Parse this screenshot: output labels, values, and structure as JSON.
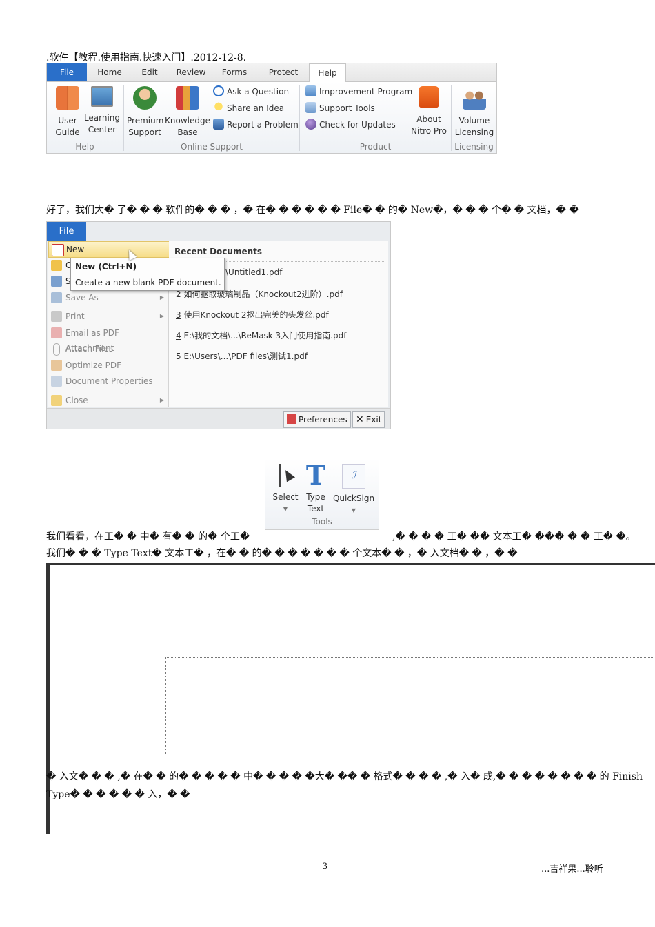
{
  "header": {
    "text": ".软件【教程.使用指南.快速入门】.2012-12-8."
  },
  "ribbon": {
    "tabs": [
      "File",
      "Home",
      "Edit",
      "Review",
      "Forms",
      "Protect",
      "Help"
    ],
    "groups": {
      "help": {
        "label": "Help",
        "user_guide": [
          "User",
          "Guide"
        ],
        "learning_center": [
          "Learning",
          "Center"
        ]
      },
      "online_support": {
        "label": "Online Support",
        "premium_support": [
          "Premium",
          "Support"
        ],
        "knowledge_base": [
          "Knowledge",
          "Base"
        ],
        "ask_question": "Ask a Question",
        "share_idea": "Share an Idea",
        "report_problem": "Report a Problem"
      },
      "product": {
        "label": "Product",
        "improvement": "Improvement Program",
        "support_tools": "Support Tools",
        "check_updates": "Check for Updates",
        "about": [
          "About",
          "Nitro Pro"
        ]
      },
      "licensing": {
        "label": "Licensing",
        "volume": [
          "Volume",
          "Licensing"
        ]
      }
    }
  },
  "para1": "好了，我们大� 了� � � 软件的� � � ，� 在� � � � � � File� � 的� New�，� � � 个� � 文档，� �",
  "file_menu": {
    "tab": "File",
    "items": {
      "new": "New",
      "open_initial": "O",
      "save_initial": "S",
      "save_as": "Save As",
      "print": "Print",
      "email": "Email as PDF Attachment",
      "attach": "Attach Files",
      "optimize": "Optimize PDF",
      "properties": "Document Properties",
      "close": "Close"
    },
    "tooltip": {
      "title": "New (Ctrl+N)",
      "desc": "Create a new blank PDF document."
    },
    "recent_header": "Recent Documents",
    "recent": [
      {
        "num": "",
        "path": "\\Untitled1.pdf"
      },
      {
        "num": "2",
        "path": " 如何抠取玻璃制品（Knockout2进阶）.pdf"
      },
      {
        "num": "3",
        "path": " 使用Knockout 2抠出完美的头发丝.pdf"
      },
      {
        "num": "4",
        "path": " E:\\我的文档\\...\\ReMask 3入门使用指南.pdf"
      },
      {
        "num": "5",
        "path": " E:\\Users\\...\\PDF files\\测试1.pdf"
      }
    ],
    "footer": {
      "preferences": "Preferences",
      "exit": "Exit"
    }
  },
  "tools": {
    "select": "Select",
    "type_text": [
      "Type",
      "Text"
    ],
    "quicksign": "QuickSign",
    "group_label": "Tools"
  },
  "para2_left": "我们看看，在工� � 中� 有� � 的� 个工�",
  "para2_right": ",� � � � 工� �� 文本工� ��� � � 工� �。",
  "para3": "我们� � � Type Text� 文本工� ，在� � 的� � � � � � � 个文本� � ，� 入文档� � ，� �",
  "para4": "� 入文� � � ,� 在� � 的� � � � � 中� � � � �大� �� � 格式� � � � ,� 入� 成,� � � � � � � � 的 Finish",
  "para5": "Type� � � � � � 入，� �",
  "footer": {
    "page": "3",
    "right": "...吉祥果...聆听"
  },
  "colors": {
    "file_tab": "#2a6fc9",
    "highlight": "#f6dd87"
  }
}
